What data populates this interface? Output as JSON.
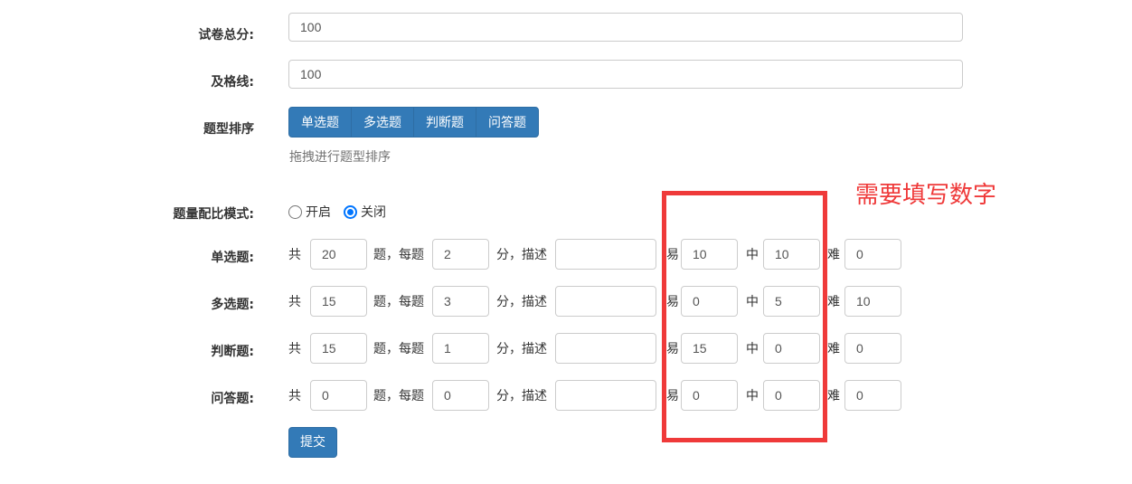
{
  "total_score": {
    "label": "试卷总分:",
    "value": "100"
  },
  "pass_line": {
    "label": "及格线:",
    "value": "100"
  },
  "type_order": {
    "label": "题型排序",
    "buttons": [
      "单选题",
      "多选题",
      "判断题",
      "问答题"
    ],
    "hint": "拖拽进行题型排序"
  },
  "ratio_mode": {
    "label": "题量配比模式:",
    "options": [
      "开启",
      "关闭"
    ],
    "selected": "关闭"
  },
  "row_text": {
    "total": "共",
    "per": "题，每题",
    "desc": "分，描述",
    "easy": "易",
    "mid": "中",
    "hard": "难"
  },
  "rows": [
    {
      "label": "单选题:",
      "count": "20",
      "score": "2",
      "desc": "",
      "easy": "10",
      "mid": "10",
      "hard": "0"
    },
    {
      "label": "多选题:",
      "count": "15",
      "score": "3",
      "desc": "",
      "easy": "0",
      "mid": "5",
      "hard": "10"
    },
    {
      "label": "判断题:",
      "count": "15",
      "score": "1",
      "desc": "",
      "easy": "15",
      "mid": "0",
      "hard": "0"
    },
    {
      "label": "问答题:",
      "count": "0",
      "score": "0",
      "desc": "",
      "easy": "0",
      "mid": "0",
      "hard": "0"
    }
  ],
  "submit_label": "提交",
  "annotation": {
    "text": "需要填写数字",
    "color": "#ef3a3a"
  },
  "accent_color": "#337ab7"
}
